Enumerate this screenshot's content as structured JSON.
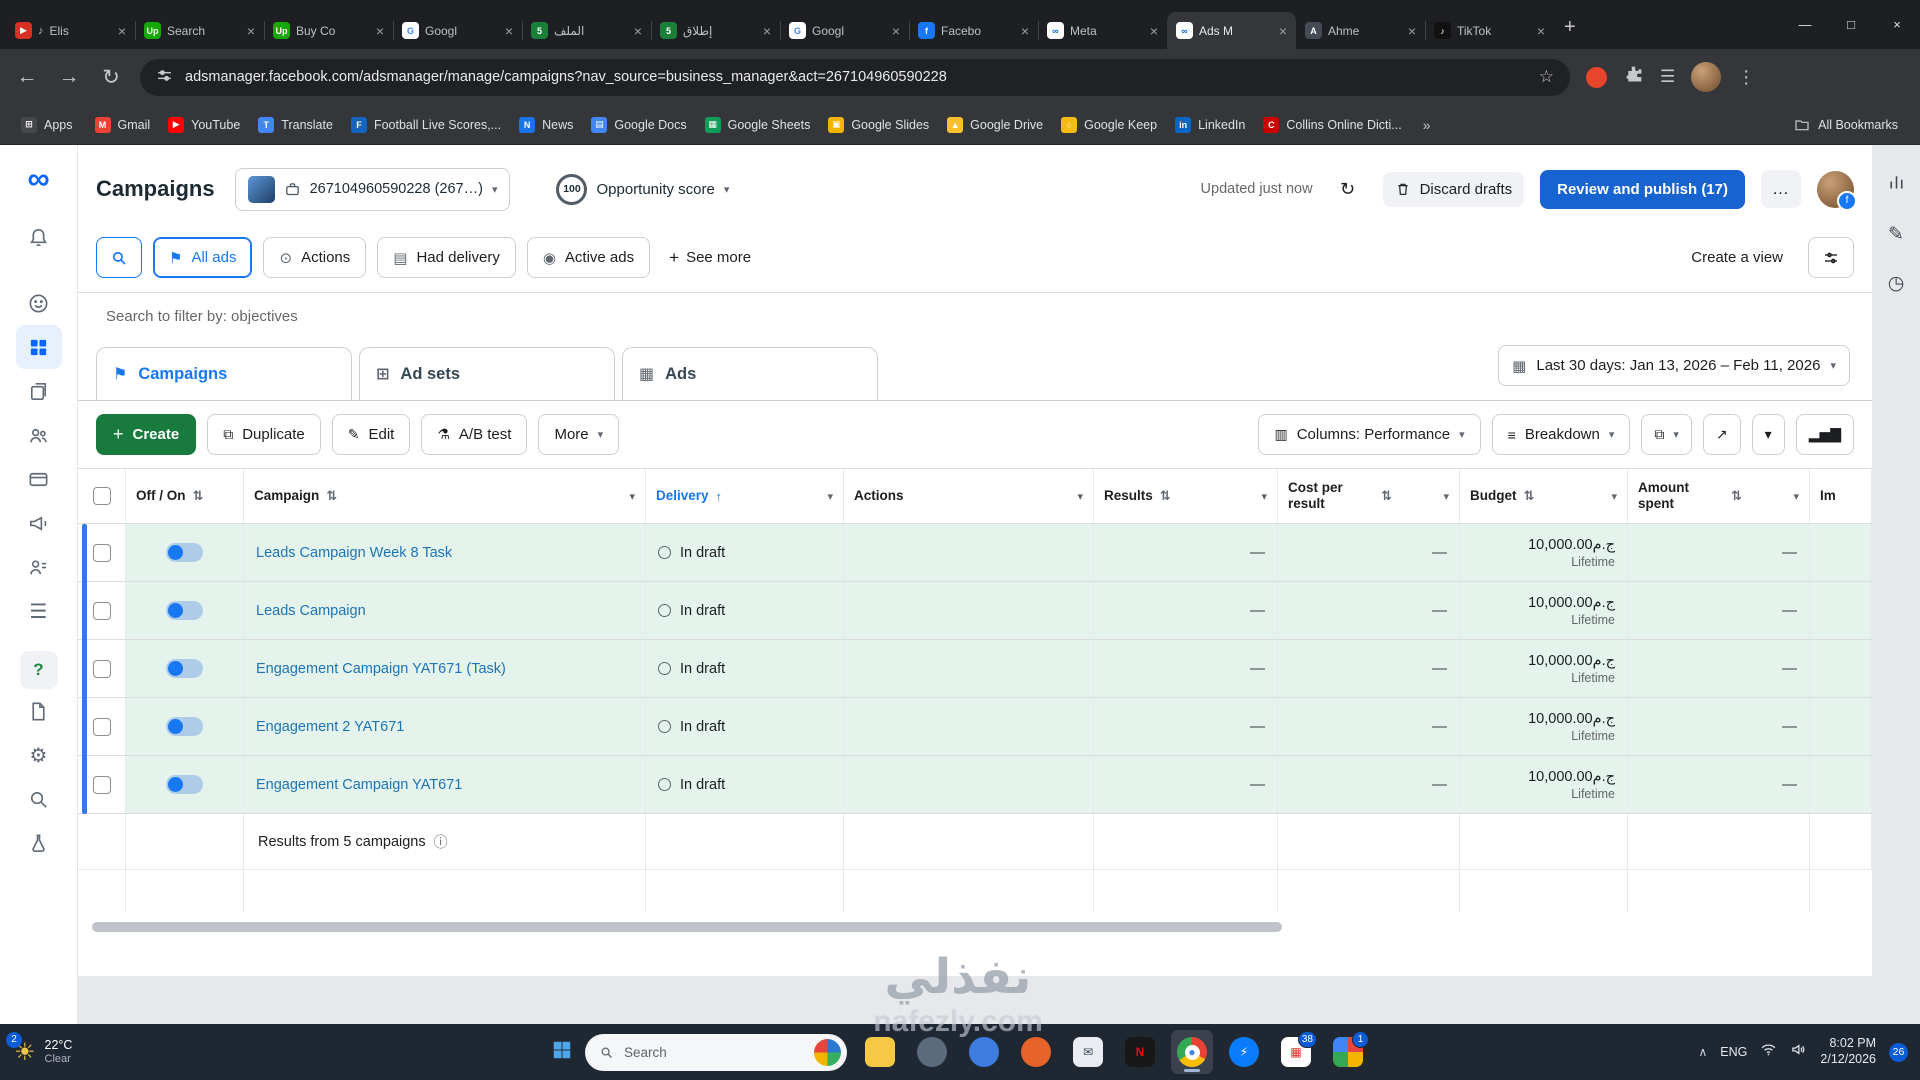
{
  "colors": {
    "accent_blue": "#1877f2",
    "publish_button": "#1763cf",
    "create_button": "#187b3d",
    "link_blue": "#1e75b5",
    "row_highlight": "#e4f3ec",
    "toggle_on": "#1877f2",
    "badge_blue": "#0b5cd6",
    "draft_bar": "#3578e5"
  },
  "browser": {
    "tab_close": "×",
    "new_tab": "+",
    "tabs": [
      {
        "label": "Elis",
        "glyph": "▶",
        "color": "#d93025",
        "audio": "♪"
      },
      {
        "label": "Search",
        "glyph": "Up",
        "color": "#14a800"
      },
      {
        "label": "Buy Co",
        "glyph": "Up",
        "color": "#14a800"
      },
      {
        "label": "Googl",
        "glyph": "G",
        "color": "#ffffff",
        "fg": "#4285f4"
      },
      {
        "label": "الملف",
        "glyph": "5",
        "color": "#188038"
      },
      {
        "label": "إطلاق",
        "glyph": "5",
        "color": "#188038"
      },
      {
        "label": "Googl",
        "glyph": "G",
        "color": "#ffffff",
        "fg": "#4285f4"
      },
      {
        "label": "Facebo",
        "glyph": "f",
        "color": "#1877f2"
      },
      {
        "label": "Meta",
        "glyph": "∞",
        "color": "#ffffff",
        "fg": "#0668e1"
      },
      {
        "label": "Ads M",
        "glyph": "∞",
        "color": "#ffffff",
        "fg": "#0668e1",
        "mods": "active"
      },
      {
        "label": "Ahme",
        "glyph": "A",
        "color": "#444b55"
      },
      {
        "label": "TikTok",
        "glyph": "♪",
        "color": "#111111"
      }
    ],
    "window_controls": [
      {
        "name": "minimize",
        "glyph": "—"
      },
      {
        "name": "maximize",
        "glyph": "□"
      },
      {
        "name": "close",
        "glyph": "×"
      }
    ],
    "toolbar": {
      "back": "←",
      "forward": "→",
      "reload": "↻",
      "star": "☆",
      "reading_list": "☰",
      "menu": "⋮",
      "url": "adsmanager.facebook.com/adsmanager/manage/campaigns?nav_source=business_manager&act=267104960590228"
    },
    "bookmarks_label_apps": "Apps",
    "apps_glyph": "⊞",
    "bookmarks": [
      {
        "label": "Gmail",
        "glyph": "M",
        "color": "#ea4335"
      },
      {
        "label": "YouTube",
        "glyph": "▶",
        "color": "#ff0000"
      },
      {
        "label": "Translate",
        "glyph": "T",
        "color": "#4285f4"
      },
      {
        "label": "Football Live Scores,...",
        "glyph": "F",
        "color": "#1565c0"
      },
      {
        "label": "News",
        "glyph": "N",
        "color": "#1a73e8"
      },
      {
        "label": "Google Docs",
        "glyph": "▤",
        "color": "#4285f4"
      },
      {
        "label": "Google Sheets",
        "glyph": "▦",
        "color": "#0f9d58"
      },
      {
        "label": "Google Slides",
        "glyph": "▣",
        "color": "#f4b400"
      },
      {
        "label": "Google Drive",
        "glyph": "▲",
        "color": "#fbc02d"
      },
      {
        "label": "Google Keep",
        "glyph": "○",
        "color": "#f5bb12"
      },
      {
        "label": "LinkedIn",
        "glyph": "in",
        "color": "#0a66c2"
      },
      {
        "label": "Collins Online Dicti...",
        "glyph": "C",
        "color": "#cc0000"
      }
    ],
    "bookmarks_overflow": "»",
    "all_bookmarks": "All Bookmarks"
  },
  "header": {
    "title": "Campaigns",
    "account": "267104960590228 (267…)",
    "account_caret": "▾",
    "opportunity_score": "100",
    "opportunity_label": "Opportunity score",
    "opportunity_caret": "▾",
    "updated": "Updated just now",
    "refresh_icon": "↻",
    "discard_label": "Discard drafts",
    "publish_label": "Review and publish (17)",
    "more_label": "…"
  },
  "filters": {
    "chips": [
      {
        "label": "All ads",
        "glyph": "⚑",
        "mods": "selected"
      },
      {
        "label": "Actions",
        "glyph": "⊙"
      },
      {
        "label": "Had delivery",
        "glyph": "▤"
      },
      {
        "label": "Active ads",
        "glyph": "◉"
      }
    ],
    "see_more_plus": "+",
    "see_more": "See more",
    "create_view": "Create a view",
    "search_placeholder": "Search to filter by: objectives"
  },
  "level_tabs": [
    {
      "label": "Campaigns",
      "glyph": "⚑",
      "mods": "active"
    },
    {
      "label": "Ad sets",
      "glyph": "⊞"
    },
    {
      "label": "Ads",
      "glyph": "▦"
    }
  ],
  "date_range": {
    "glyph": "▦",
    "label": "Last 30 days: Jan 13, 2026 – Feb 11, 2026",
    "caret": "▾"
  },
  "toolbar": {
    "create_plus": "+",
    "create_label": "Create",
    "buttons": [
      {
        "label": "Duplicate",
        "glyph": "⧉"
      },
      {
        "label": "Edit",
        "glyph": "✎"
      },
      {
        "label": "A/B test",
        "glyph": "⚗"
      },
      {
        "label": "More",
        "caret": "▾"
      }
    ],
    "columns": {
      "glyph": "▥",
      "label": "Columns: Performance",
      "caret": "▾"
    },
    "breakdown": {
      "glyph": "≡",
      "label": "Breakdown",
      "caret": "▾"
    },
    "icon_buttons": [
      {
        "glyph": "⧉",
        "caret": "▾"
      },
      {
        "glyph": "↗"
      },
      {
        "glyph": "▾"
      },
      {
        "glyph": "▂▅▇"
      }
    ]
  },
  "table": {
    "columns": [
      {
        "label": "Off / On",
        "sort": "⇅"
      },
      {
        "label": "Campaign",
        "sort": "⇅",
        "caret": "▾"
      },
      {
        "label": "Delivery",
        "sort": "↑",
        "caret": "▾",
        "mods": "sorted"
      },
      {
        "label": "Actions",
        "caret": "▾"
      },
      {
        "label": "Results",
        "sort": "⇅",
        "caret": "▾"
      },
      {
        "label": "Cost per result",
        "sort": "⇅",
        "caret": "▾"
      },
      {
        "label": "Budget",
        "sort": "⇅",
        "caret": "▾"
      },
      {
        "label": "Amount spent",
        "sort": "⇅",
        "caret": "▾"
      },
      {
        "label": "Im"
      }
    ],
    "rows": [
      {
        "name": "Leads Campaign Week 8 Task",
        "delivery": "In draft",
        "results": "—",
        "cost_per_result": "—",
        "budget": "10,000.00ج.م",
        "budget_type": "Lifetime",
        "amount_spent": "—"
      },
      {
        "name": "Leads Campaign",
        "delivery": "In draft",
        "results": "—",
        "cost_per_result": "—",
        "budget": "10,000.00ج.م",
        "budget_type": "Lifetime",
        "amount_spent": "—"
      },
      {
        "name": "Engagement Campaign YAT671 (Task)",
        "delivery": "In draft",
        "results": "—",
        "cost_per_result": "—",
        "budget": "10,000.00ج.م",
        "budget_type": "Lifetime",
        "amount_spent": "—"
      },
      {
        "name": "Engagement 2 YAT671",
        "delivery": "In draft",
        "results": "—",
        "cost_per_result": "—",
        "budget": "10,000.00ج.م",
        "budget_type": "Lifetime",
        "amount_spent": "—"
      },
      {
        "name": "Engagement Campaign YAT671",
        "delivery": "In draft",
        "results": "—",
        "cost_per_result": "—",
        "budget": "10,000.00ج.م",
        "budget_type": "Lifetime",
        "amount_spent": "—"
      }
    ],
    "footer": "Results from 5 campaigns",
    "footer_info": "ⓘ"
  },
  "taskbar": {
    "weather": {
      "badge": "2",
      "icon": "☀",
      "temp": "22°C",
      "cond": "Clear"
    },
    "search_label": "Search",
    "icons": [
      {
        "name": "file-explorer",
        "color": "#f6c944"
      },
      {
        "name": "app-steel",
        "color": "#5b6b7d",
        "mods": "round"
      },
      {
        "name": "edge-browser",
        "color": "#3d7de0",
        "mods": "round"
      },
      {
        "name": "brave-browser",
        "color": "#e8622c",
        "mods": "round"
      },
      {
        "name": "mail",
        "color": "#e9edf2",
        "glyph": "✉",
        "fg": "#3a4654"
      },
      {
        "name": "netflix",
        "color": "#181818",
        "glyph": "N",
        "fg": "#e50914"
      },
      {
        "name": "chrome",
        "color": "conic-gradient(#ea4335 0 33%,#fbbc05 0 66%,#34a853 0 100%)",
        "glyph": "●",
        "fg": "#4285f4",
        "glyph_bg": "#ffffff",
        "mods": "round active"
      },
      {
        "name": "messenger",
        "color": "#0a7cff",
        "glyph": "⚡",
        "fg": "#ffffff",
        "mods": "round"
      },
      {
        "name": "calendar",
        "color": "#ffffff",
        "glyph": "▦",
        "fg": "#d93025",
        "badge": "38"
      },
      {
        "name": "photos",
        "color": "conic-gradient(#e8453c 0 25%,#f4b400 0 50%,#34a853 0 75%,#4285f4 0 100%)",
        "badge": "1"
      }
    ],
    "tray": {
      "chevron": "∧",
      "lang": "ENG",
      "time": "8:02 PM",
      "date": "2/12/2026",
      "badge": "26"
    }
  },
  "watermark": {
    "ar": "نفذلي",
    "latin": "nafezly.com"
  }
}
